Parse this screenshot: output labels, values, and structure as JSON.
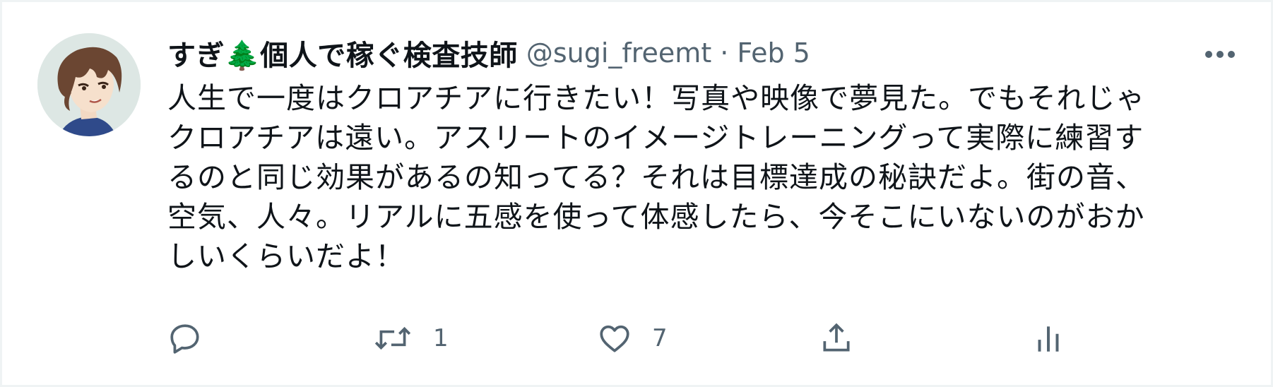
{
  "tweet": {
    "display_name": "すぎ🌲個人で稼ぐ検査技師",
    "handle": "@sugi_freemt",
    "separator": "·",
    "date": "Feb 5",
    "text": "人生で一度はクロアチアに行きたい！写真や映像で夢見た。でもそれじゃ\nクロアチアは遠い。アスリートのイメージトレーニングって実際に練習す\nるのと同じ効果があるの知ってる？それは目標達成の秘訣だよ。街の音、\n空気、人々。リアルに五感を使って体感したら、今そこにいないのがおか\nしいくらいだよ！"
  },
  "actions": {
    "reply": {
      "icon": "reply-icon",
      "count": ""
    },
    "retweet": {
      "icon": "retweet-icon",
      "count": "1"
    },
    "like": {
      "icon": "heart-icon",
      "count": "7"
    },
    "share": {
      "icon": "share-icon",
      "count": ""
    },
    "analytics": {
      "icon": "analytics-icon",
      "count": ""
    }
  },
  "colors": {
    "text": "#0f1419",
    "secondary": "#536471",
    "border": "#eff3f4"
  }
}
